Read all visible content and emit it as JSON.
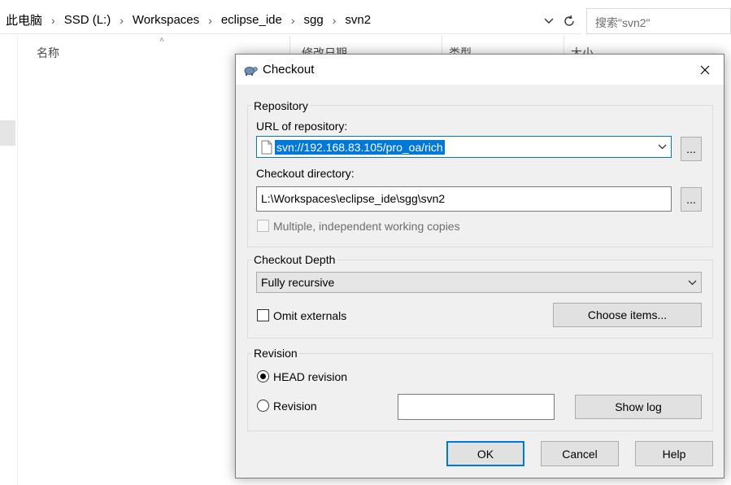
{
  "explorer": {
    "breadcrumbs": [
      "此电脑",
      "SSD (L:)",
      "Workspaces",
      "eclipse_ide",
      "sgg",
      "svn2"
    ],
    "search_placeholder": "搜索\"svn2\"",
    "columns": [
      "名称",
      "修改日期",
      "类型",
      "大小"
    ]
  },
  "dialog": {
    "title": "Checkout",
    "repository": {
      "group_label": "Repository",
      "url_label": "URL of repository:",
      "url_value": "svn://192.168.83.105/pro_oa/rich",
      "url_browse": "...",
      "dir_label": "Checkout directory:",
      "dir_value": "L:\\Workspaces\\eclipse_ide\\sgg\\svn2",
      "dir_browse": "...",
      "multiple_label": "Multiple, independent working copies"
    },
    "depth": {
      "group_label": "Checkout Depth",
      "selected": "Fully recursive",
      "omit_label": "Omit externals",
      "choose_items": "Choose items..."
    },
    "revision": {
      "group_label": "Revision",
      "head_label": "HEAD revision",
      "revision_label": "Revision",
      "revision_value": "",
      "show_log": "Show log"
    },
    "buttons": {
      "ok": "OK",
      "cancel": "Cancel",
      "help": "Help"
    }
  },
  "colors": {
    "accent": "#0078d7",
    "dialog_bg": "#f0f0f0",
    "button_bg": "#e1e1e1"
  }
}
